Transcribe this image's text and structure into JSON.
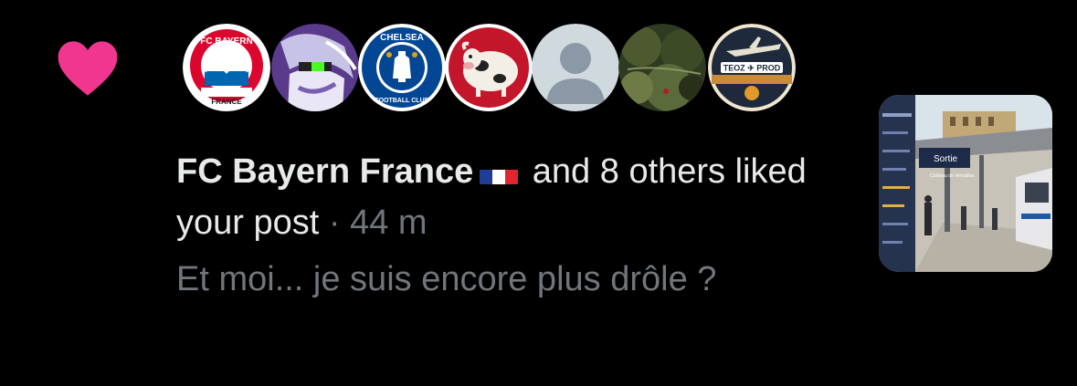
{
  "notification": {
    "type": "like",
    "actor_name": "FC Bayern France",
    "actor_flag": "french-flag",
    "action_text": " and 8 others liked your post",
    "separator": " · ",
    "time_ago": "44 m",
    "post_excerpt": "Et moi... je suis encore plus drôle ?",
    "heart_color": "#f0368e"
  },
  "avatars": [
    {
      "name": "fc-bayern-france-logo",
      "top_text": "FC BAYERN",
      "bottom_text": "FRANCE"
    },
    {
      "name": "anime-character-avatar"
    },
    {
      "name": "chelsea-fc-crest",
      "top_text": "CHELSEA",
      "bottom_text": "FOOTBALL CLUB"
    },
    {
      "name": "cartoon-cow-avatar"
    },
    {
      "name": "default-profile-avatar"
    },
    {
      "name": "forest-photo-avatar"
    },
    {
      "name": "teoz-prod-logo",
      "text": "TEOZ ✈ PROD"
    }
  ],
  "media_thumbnail": {
    "sign_text": "Sortie",
    "sub_text": "Château de Versailles"
  }
}
